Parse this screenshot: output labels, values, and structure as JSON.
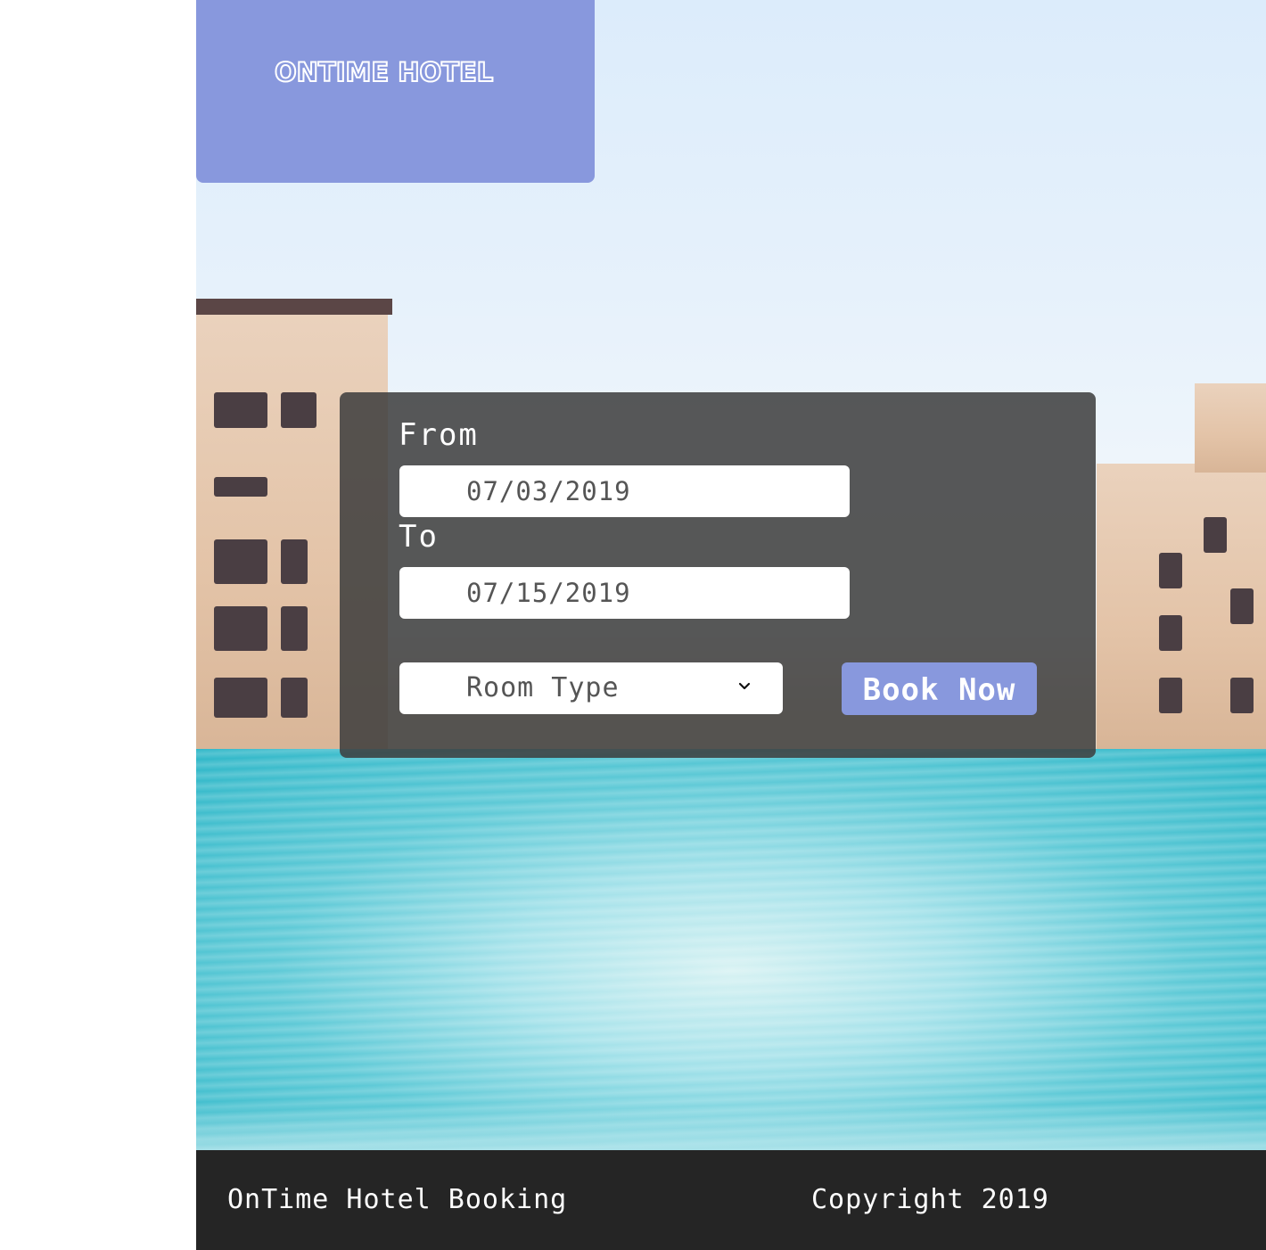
{
  "brand": {
    "logo_text": "ONTIME HOTEL",
    "color": "#8898dd"
  },
  "booking": {
    "from_label": "From",
    "from_value": "07/03/2019",
    "to_label": "To",
    "to_value": "07/15/2019",
    "room_type_selected": "Room Type",
    "dropdown_icon": "chevron-down-icon",
    "submit_label": "Book Now"
  },
  "footer": {
    "left_text": "OnTime Hotel Booking",
    "right_text": "Copyright 2019",
    "background": "#252525"
  }
}
